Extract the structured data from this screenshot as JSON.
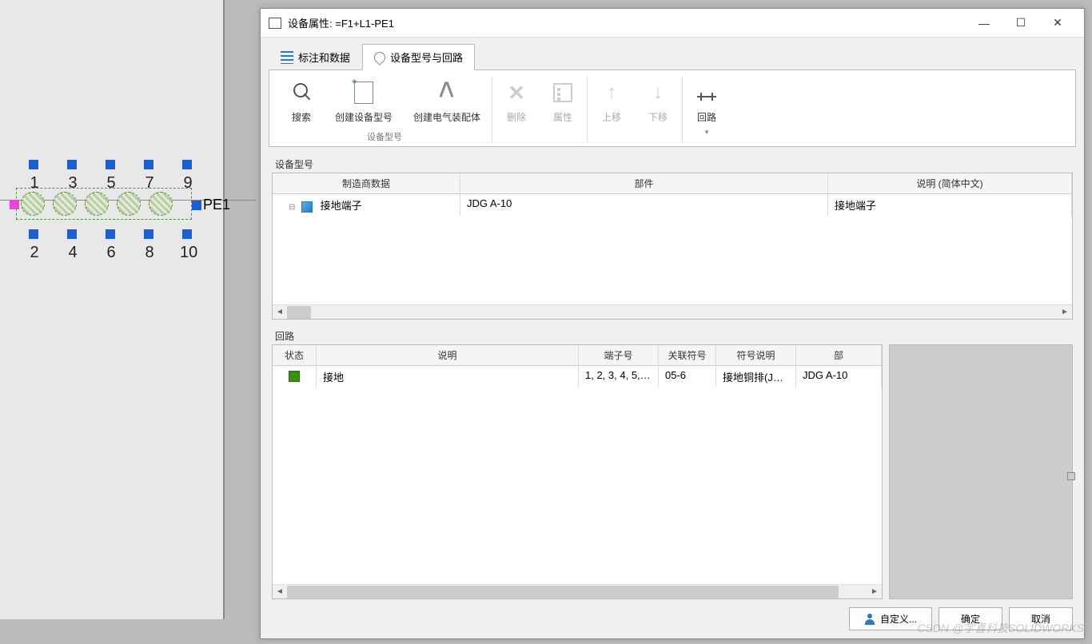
{
  "dialog": {
    "title": "设备属性: =F1+L1-PE1"
  },
  "tabs": {
    "tab1": "标注和数据",
    "tab2": "设备型号与回路"
  },
  "ribbon": {
    "search": "搜索",
    "create_part": "创建设备型号",
    "create_assy": "创建电气装配体",
    "delete": "删除",
    "props": "属性",
    "move_up": "上移",
    "move_down": "下移",
    "circuit": "回路",
    "group_part": "设备型号"
  },
  "table1": {
    "label": "设备型号",
    "cols": {
      "mfr": "制造商数据",
      "part": "部件",
      "desc": "说明 (简体中文)"
    },
    "rows": [
      {
        "mfr": "接地端子",
        "part": "JDG A-10",
        "desc": "接地端子"
      }
    ]
  },
  "circuit": {
    "label": "回路",
    "cols": {
      "status": "状态",
      "desc": "说明",
      "termno": "端子号",
      "assoc": "关联符号",
      "symdesc": "符号说明",
      "part": "部"
    },
    "rows": [
      {
        "desc": "接地",
        "termno": "1, 2, 3, 4, 5, 6, ...",
        "assoc": "05-6",
        "symdesc": "接地铜排(JD...",
        "part": "JDG A-10"
      }
    ]
  },
  "footer": {
    "customize": "自定义...",
    "ok": "确定",
    "cancel": "取消"
  },
  "terminals": {
    "top": [
      "1",
      "3",
      "5",
      "7",
      "9"
    ],
    "bottom": [
      "2",
      "4",
      "6",
      "8",
      "10"
    ],
    "label": "PE1"
  },
  "watermark": "CSDN @宇喜科技SOLIDWORKS"
}
